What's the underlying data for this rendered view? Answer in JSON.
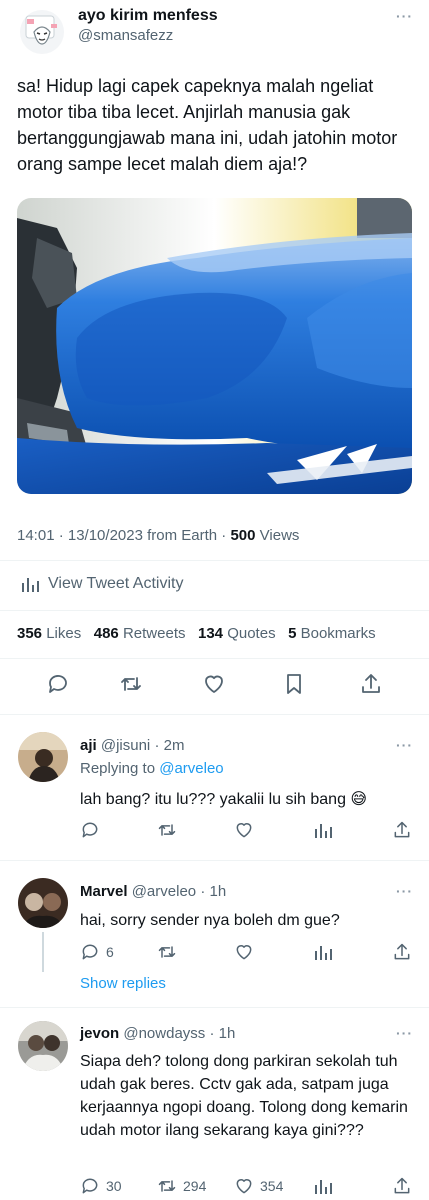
{
  "main_tweet": {
    "display_name": "ayo kirim menfess",
    "handle": "@smansafezz",
    "text": "sa! Hidup lagi capek capeknya malah ngeliat motor tiba tiba lecet. Anjirlah manusia gak bertanggungjawab mana ini, udah jatohin motor orang sampe lecet malah diem aja!?",
    "image_description": "photo of a blue motorcycle fuel tank",
    "timestamp": "14:01 · 13/10/2023 from Earth · ",
    "views_count": "500",
    "views_label": " Views",
    "activity_label": "View Tweet Activity",
    "stats": {
      "likes_count": "356",
      "likes_label": "Likes",
      "retweets_count": "486",
      "retweets_label": "Retweets",
      "quotes_count": "134",
      "quotes_label": "Quotes",
      "bookmarks_count": "5",
      "bookmarks_label": "Bookmarks"
    },
    "actions": [
      "reply-icon",
      "retweet-icon",
      "like-icon",
      "bookmark-icon",
      "share-icon"
    ]
  },
  "replies": [
    {
      "display_name": "aji",
      "handle": "@jisuni",
      "time": "· 2m",
      "replying_prefix": "Replying to ",
      "replying_to": "@arveleo",
      "text": "lah bang? itu lu??? yakalii lu sih bang 😅",
      "reply_count": "",
      "retweet_count": "",
      "like_count": ""
    },
    {
      "display_name": "Marvel",
      "handle": "@arveleo",
      "time": "· 1h",
      "text": "hai, sorry sender nya boleh dm gue?",
      "reply_count": "6",
      "retweet_count": "",
      "like_count": "",
      "show_replies": "Show replies"
    },
    {
      "display_name": "jevon",
      "handle": "@nowdayss",
      "time": "· 1h",
      "text": "Siapa deh? tolong dong parkiran sekolah tuh udah gak beres. Cctv gak ada, satpam juga kerjaannya ngopi doang. Tolong dong kemarin udah motor ilang sekarang kaya gini???",
      "reply_count": "30",
      "retweet_count": "294",
      "like_count": "354"
    }
  ],
  "colors": {
    "link": "#1d9bf0",
    "muted": "#536471",
    "text": "#0f1419",
    "divider": "#eff3f4"
  }
}
